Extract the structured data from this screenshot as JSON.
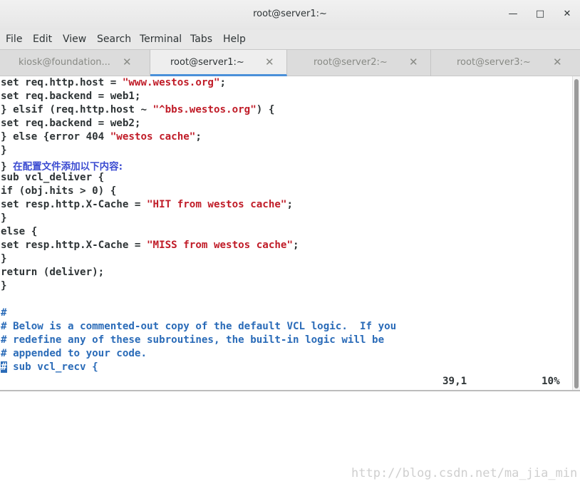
{
  "window": {
    "title": "root@server1:~"
  },
  "menu": [
    "File",
    "Edit",
    "View",
    "Search",
    "Terminal",
    "Tabs",
    "Help"
  ],
  "tabs": [
    {
      "label": "kiosk@foundation...",
      "active": false
    },
    {
      "label": "root@server1:~",
      "active": true
    },
    {
      "label": "root@server2:~",
      "active": false
    },
    {
      "label": "root@server3:~",
      "active": false
    }
  ],
  "terminal_lines": [
    [
      [
        "n",
        "set req.http.host = "
      ],
      [
        "s",
        "\"www.westos.org\""
      ],
      [
        "n",
        ";"
      ]
    ],
    [
      [
        "n",
        "set req.backend = web1;"
      ]
    ],
    [
      [
        "n",
        "} elsif (req.http.host ~ "
      ],
      [
        "s",
        "\"^bbs.westos.org\""
      ],
      [
        "n",
        ") {"
      ]
    ],
    [
      [
        "n",
        "set req.backend = web2;"
      ]
    ],
    [
      [
        "n",
        "} else {error 404 "
      ],
      [
        "s",
        "\"westos cache\""
      ],
      [
        "n",
        ";"
      ]
    ],
    [
      [
        "n",
        "}"
      ]
    ],
    [
      [
        "n",
        "} "
      ],
      [
        "cn",
        "在配置文件添加以下内容:"
      ]
    ],
    [
      [
        "n",
        "sub vcl_deliver {"
      ]
    ],
    [
      [
        "n",
        "if (obj.hits > 0) {"
      ]
    ],
    [
      [
        "n",
        "set resp.http.X-Cache = "
      ],
      [
        "s",
        "\"HIT from westos cache\""
      ],
      [
        "n",
        ";"
      ]
    ],
    [
      [
        "n",
        "}"
      ]
    ],
    [
      [
        "n",
        "else {"
      ]
    ],
    [
      [
        "n",
        "set resp.http.X-Cache = "
      ],
      [
        "s",
        "\"MISS from westos cache\""
      ],
      [
        "n",
        ";"
      ]
    ],
    [
      [
        "n",
        "}"
      ]
    ],
    [
      [
        "n",
        "return (deliver);"
      ]
    ],
    [
      [
        "n",
        "}"
      ]
    ],
    [
      [
        "n",
        ""
      ]
    ],
    [
      [
        "c",
        "#"
      ]
    ],
    [
      [
        "c",
        "# Below is a commented-out copy of the default VCL logic.  If you"
      ]
    ],
    [
      [
        "c",
        "# redefine any of these subroutines, the built-in logic will be"
      ]
    ],
    [
      [
        "c",
        "# appended to your code."
      ]
    ],
    [
      [
        "k",
        "#"
      ],
      [
        "c",
        " sub vcl_recv {"
      ]
    ]
  ],
  "status": {
    "position": "39,1",
    "percent": "10%"
  },
  "watermark": "http://blog.csdn.net/ma_jia_min",
  "colors": {
    "string": "#c01c28",
    "comment": "#2a6bb8",
    "tab_accent": "#4a90d9"
  }
}
